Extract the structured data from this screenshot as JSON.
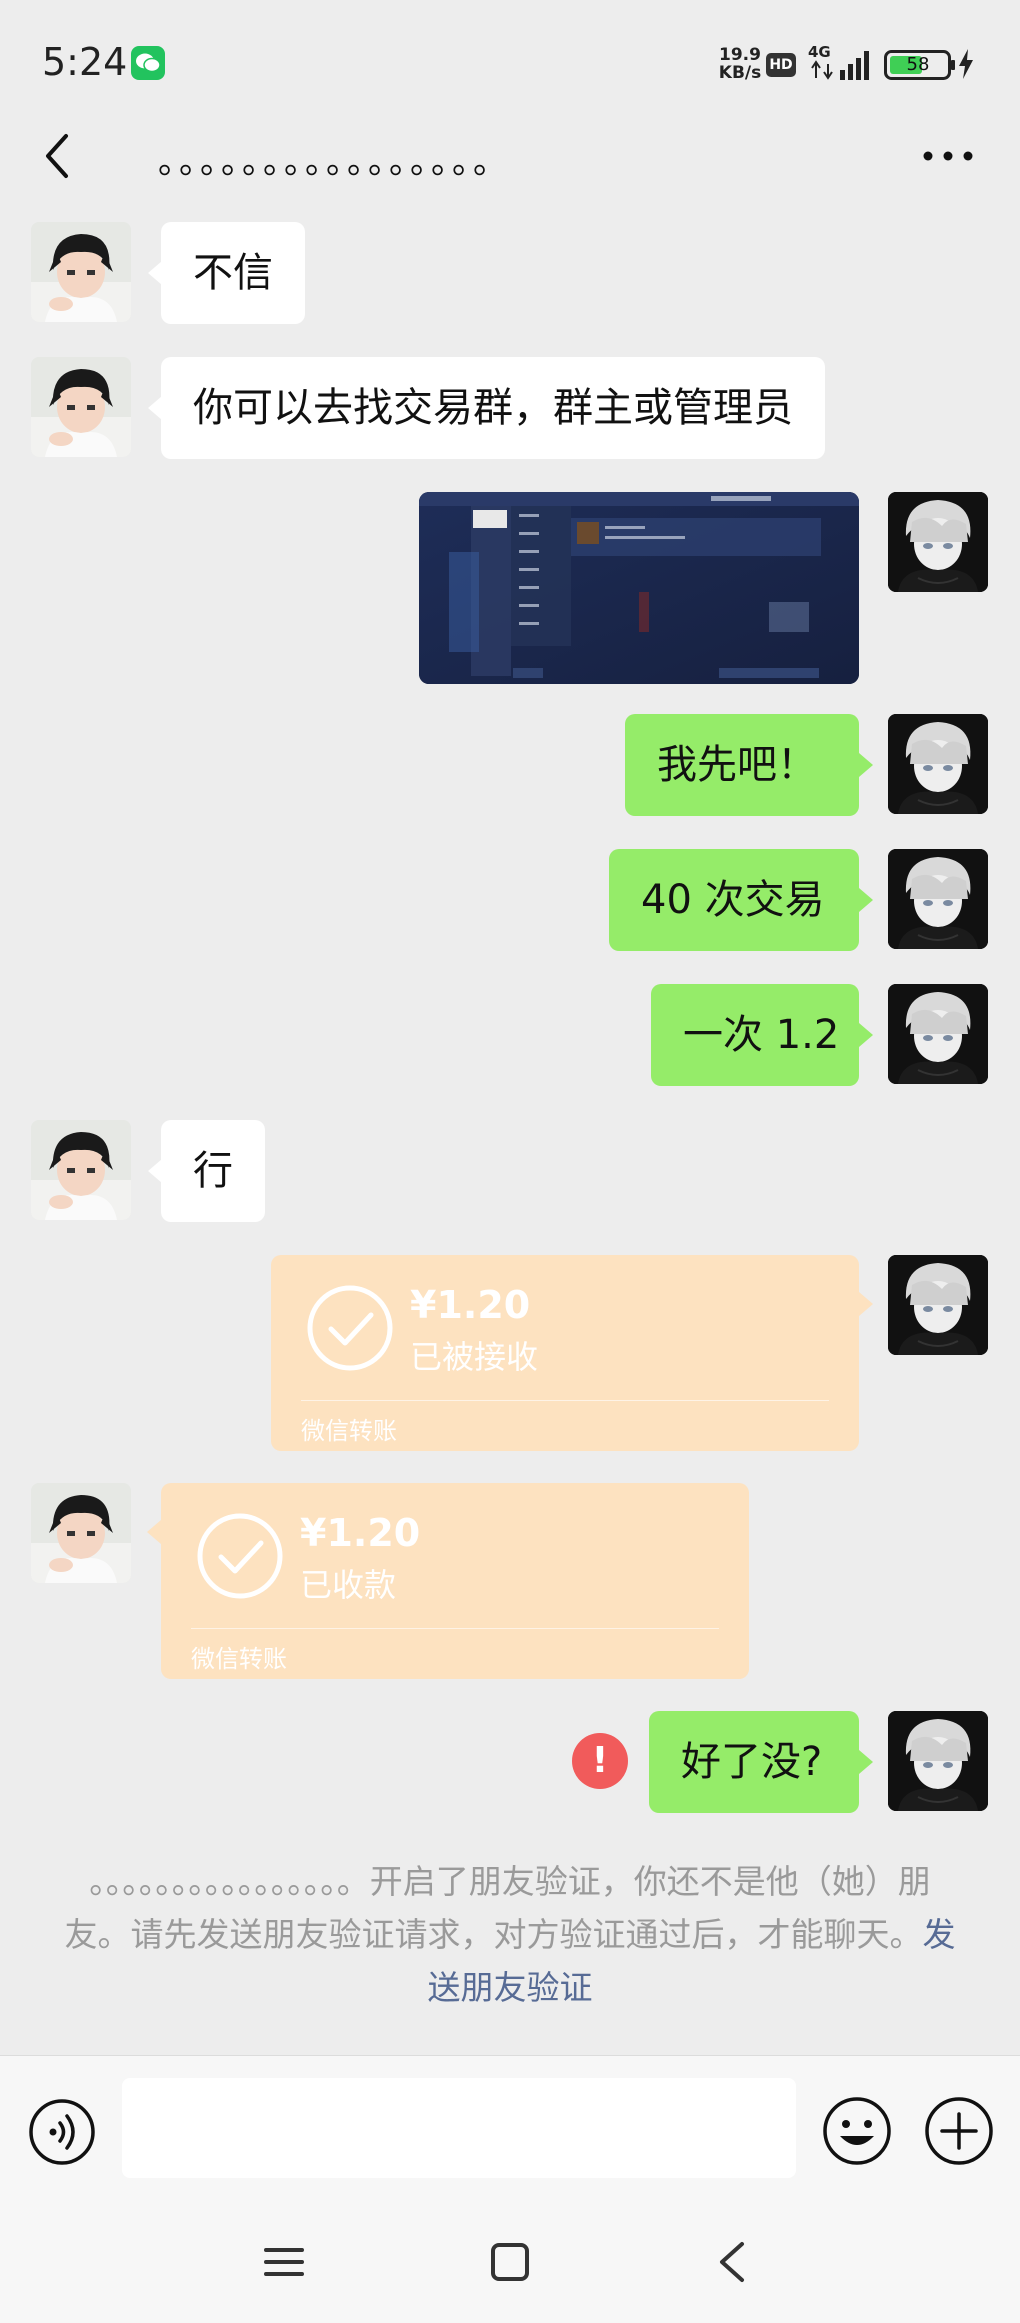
{
  "status_bar": {
    "time": "5:24",
    "speed_value": "19.9",
    "speed_unit": "KB/s",
    "hd": "HD",
    "network": "4G",
    "battery": "58"
  },
  "header": {
    "title": "。。。。。。。。。。。。。。。。"
  },
  "messages": {
    "m1": "不信",
    "m2": "你可以去找交易群，群主或管理员",
    "m4": "我先吧！",
    "m5": "40 次交易",
    "m6": "一次 1.2",
    "m7": "行",
    "m10": "好了没?"
  },
  "transfer_sent": {
    "amount": "¥1.20",
    "status": "已被接收",
    "footer": "微信转账"
  },
  "transfer_received": {
    "amount": "¥1.20",
    "status": "已收款",
    "footer": "微信转账"
  },
  "error_mark": "!",
  "notice": {
    "text": "。。。。。。。。。。。。。。。。开启了朋友验证，你还不是他（她）朋友。请先发送朋友验证请求，对方验证通过后，才能聊天。",
    "link": "发送朋友验证"
  },
  "colors": {
    "bubble_self": "#95ec69",
    "bubble_other": "#ffffff",
    "transfer_card": "#fde2c0",
    "link": "#576b95",
    "error": "#f15b5b",
    "background": "#ededed"
  },
  "icons": [
    "wechat-icon",
    "back-arrow-icon",
    "more-icon",
    "check-circle-icon",
    "error-icon",
    "voice-icon",
    "emoji-icon",
    "plus-icon",
    "menu-icon",
    "home-icon",
    "nav-back-icon"
  ]
}
